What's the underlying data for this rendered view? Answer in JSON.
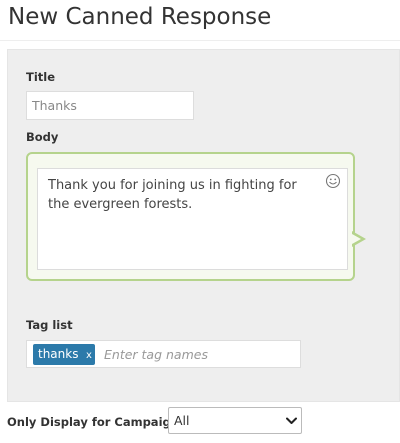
{
  "page": {
    "title": "New Canned Response"
  },
  "form": {
    "title_label": "Title",
    "title_value": "Thanks",
    "body_label": "Body",
    "body_value": "Thank you for joining us in fighting for the evergreen forests.",
    "tag_label": "Tag list",
    "tags": [
      {
        "label": "thanks",
        "remove_label": "x"
      }
    ],
    "tag_placeholder": "Enter tag names",
    "campaign_label": "Only Display for Campaign:",
    "campaign_selected": "All"
  },
  "icons": {
    "body_emoji": "smiley-icon",
    "select_arrow": "chevron-down-icon"
  },
  "colors": {
    "tag_chip": "#2c7aaa",
    "bubble_border": "#b5d38c",
    "panel_bg": "#eeeeee"
  }
}
